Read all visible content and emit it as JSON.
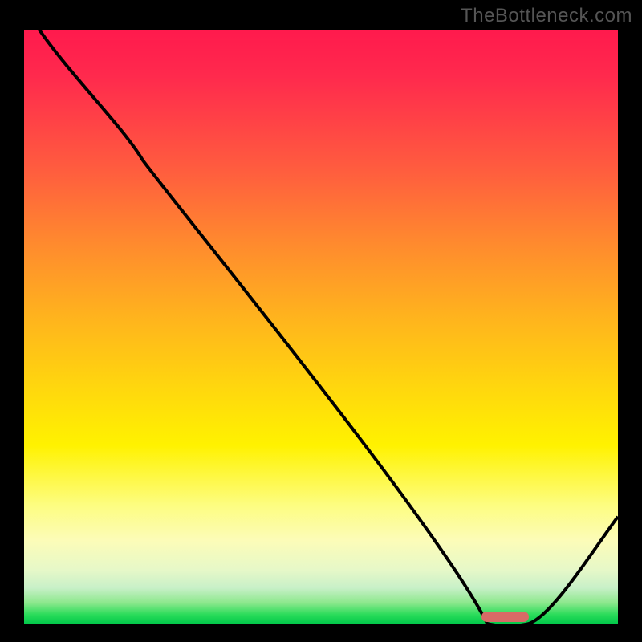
{
  "watermark": "TheBottleneck.com",
  "chart_data": {
    "type": "line",
    "title": "",
    "xlabel": "",
    "ylabel": "",
    "xlim": [
      0,
      100
    ],
    "ylim": [
      0,
      100
    ],
    "x": [
      0,
      20,
      78,
      85,
      100
    ],
    "values": [
      104,
      78,
      0,
      0,
      18
    ],
    "background_gradient": {
      "top": "high",
      "bottom": "low",
      "colors": [
        "#ff1a4d",
        "#ff8a2e",
        "#ffd60e",
        "#fdfd80",
        "#02c84a"
      ]
    },
    "marker": {
      "shape": "rounded-bar",
      "color": "#d86a66",
      "x_range": [
        77,
        85
      ],
      "y": 1.2
    }
  }
}
